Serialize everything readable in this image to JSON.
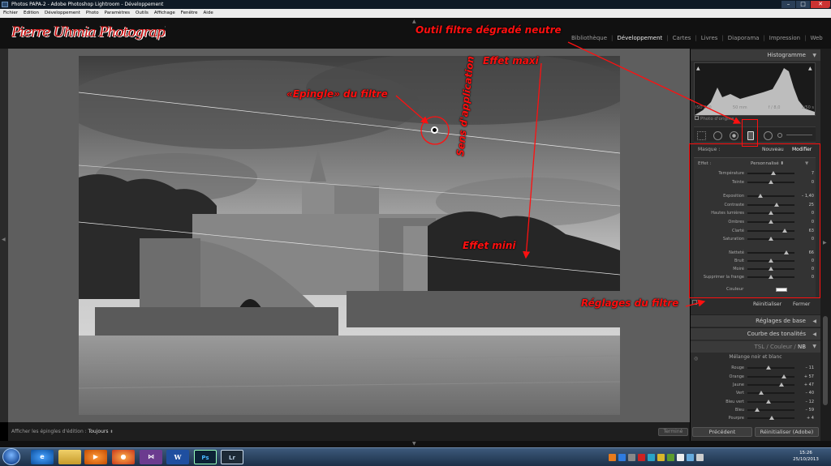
{
  "window": {
    "title": "Photos PAPA-2 - Adobe Photoshop Lightroom - Développement",
    "min_icon": "minimize-icon",
    "max_icon": "maximize-icon",
    "close_icon": "close-icon"
  },
  "menu": [
    "Fichier",
    "Edition",
    "Développement",
    "Photo",
    "Paramètres",
    "Outils",
    "Affichage",
    "Fenêtre",
    "Aide"
  ],
  "identity_plate": "Pierre Uhmia Photographie",
  "modules": [
    "Bibliothèque",
    "Développement",
    "Cartes",
    "Livres",
    "Diaporama",
    "Impression",
    "Web"
  ],
  "active_module": "Développement",
  "bottom_toolbar": {
    "pins_label": "Afficher les épingles d'édition :",
    "pins_value": "Toujours",
    "done_label": "Terminé"
  },
  "panels": {
    "histogram": "Histogramme",
    "histo_info": [
      "ISO 200",
      "50 mm",
      "f / 8,0",
      "1/50 s"
    ],
    "original_photo": "Photo d'origine",
    "mask_label": "Masque :",
    "mask_new": "Nouveau",
    "mask_edit": "Modifier",
    "effect_label": "Effet :",
    "effect_value": "Personnalisé",
    "color_label": "Couleur",
    "reset_label": "Réinitialiser",
    "close_label": "Fermer",
    "basic": "Réglages de base",
    "tone_curve": "Courbe des tonalités",
    "hsl_tabs": {
      "tsl": "TSL",
      "sep1": "/",
      "color": "Couleur",
      "sep2": "/",
      "nb": "NB"
    },
    "bw_mix": "Mélange noir et blanc"
  },
  "filter_sliders": [
    {
      "label": "Température",
      "value": "7",
      "pos": 0.56
    },
    {
      "label": "Teinte",
      "value": "0",
      "pos": 0.5
    },
    {
      "label": "Exposition",
      "value": "– 1,40",
      "pos": 0.28
    },
    {
      "label": "Contraste",
      "value": "25",
      "pos": 0.62
    },
    {
      "label": "Hautes lumières",
      "value": "0",
      "pos": 0.5
    },
    {
      "label": "Ombres",
      "value": "0",
      "pos": 0.5
    },
    {
      "label": "Clarté",
      "value": "63",
      "pos": 0.8
    },
    {
      "label": "Saturation",
      "value": "0",
      "pos": 0.5
    },
    {
      "label": "Netteté",
      "value": "66",
      "pos": 0.82
    },
    {
      "label": "Bruit",
      "value": "0",
      "pos": 0.5
    },
    {
      "label": "Moiré",
      "value": "0",
      "pos": 0.5
    },
    {
      "label": "Supprimer la frange",
      "value": "0",
      "pos": 0.5
    }
  ],
  "bw_sliders": [
    {
      "label": "Rouge",
      "value": "– 11",
      "pos": 0.44
    },
    {
      "label": "Orange",
      "value": "+ 57",
      "pos": 0.78
    },
    {
      "label": "Jaune",
      "value": "+ 47",
      "pos": 0.72
    },
    {
      "label": "Vert",
      "value": "– 40",
      "pos": 0.3
    },
    {
      "label": "Bleu vert",
      "value": "– 12",
      "pos": 0.44
    },
    {
      "label": "Bleu",
      "value": "– 59",
      "pos": 0.2
    },
    {
      "label": "Pourpre",
      "value": "+ 4",
      "pos": 0.52
    }
  ],
  "footer": {
    "previous": "Précédent",
    "reset_adobe": "Réinitialiser (Adobe)"
  },
  "clock": {
    "time": "15:26",
    "date": "25/10/2013"
  },
  "annotations": {
    "tool": "Outil filtre dégradé neutre",
    "effect_max": "Effet maxi",
    "pin": "«Epingle» du filtre",
    "direction": "Sens d'application",
    "effect_min": "Effet mini",
    "settings": "Réglages du filtre"
  },
  "colors": {
    "annotation": "#ff1010",
    "panel_bg": "#2c2c2c",
    "workspace": "#5e5e5e"
  }
}
